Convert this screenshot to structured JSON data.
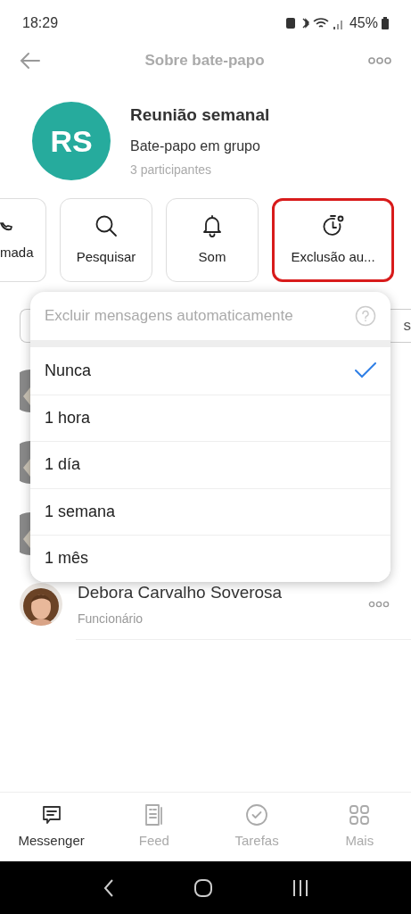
{
  "status_bar": {
    "time": "18:29",
    "battery": "45%"
  },
  "header": {
    "title": "Sobre bate-papo"
  },
  "chat": {
    "initials": "RS",
    "name": "Reunião semanal",
    "type": "Bate-papo em grupo",
    "participants": "3 participantes"
  },
  "actions": [
    {
      "kind": "call",
      "label": "mada",
      "highlighted": false
    },
    {
      "kind": "search",
      "label": "Pesquisar",
      "highlighted": false
    },
    {
      "kind": "bell",
      "label": "Som",
      "highlighted": false
    },
    {
      "kind": "timer",
      "label": "Exclusão au...",
      "highlighted": true
    }
  ],
  "filter_chip": {
    "label": "s"
  },
  "members": [
    {
      "name": "Debora Carvalho Soverosa",
      "role": "Funcionário"
    }
  ],
  "popup": {
    "title": "Excluir mensagens automaticamente",
    "options": [
      {
        "label": "Nunca",
        "selected": true
      },
      {
        "label": "1 hora",
        "selected": false
      },
      {
        "label": "1 día",
        "selected": false
      },
      {
        "label": "1 semana",
        "selected": false
      },
      {
        "label": "1 mês",
        "selected": false
      }
    ]
  },
  "nav": [
    {
      "kind": "chat",
      "label": "Messenger",
      "selected": true
    },
    {
      "kind": "feed",
      "label": "Feed",
      "selected": false
    },
    {
      "kind": "tasks",
      "label": "Tarefas",
      "selected": false
    },
    {
      "kind": "more",
      "label": "Mais",
      "selected": false
    }
  ]
}
